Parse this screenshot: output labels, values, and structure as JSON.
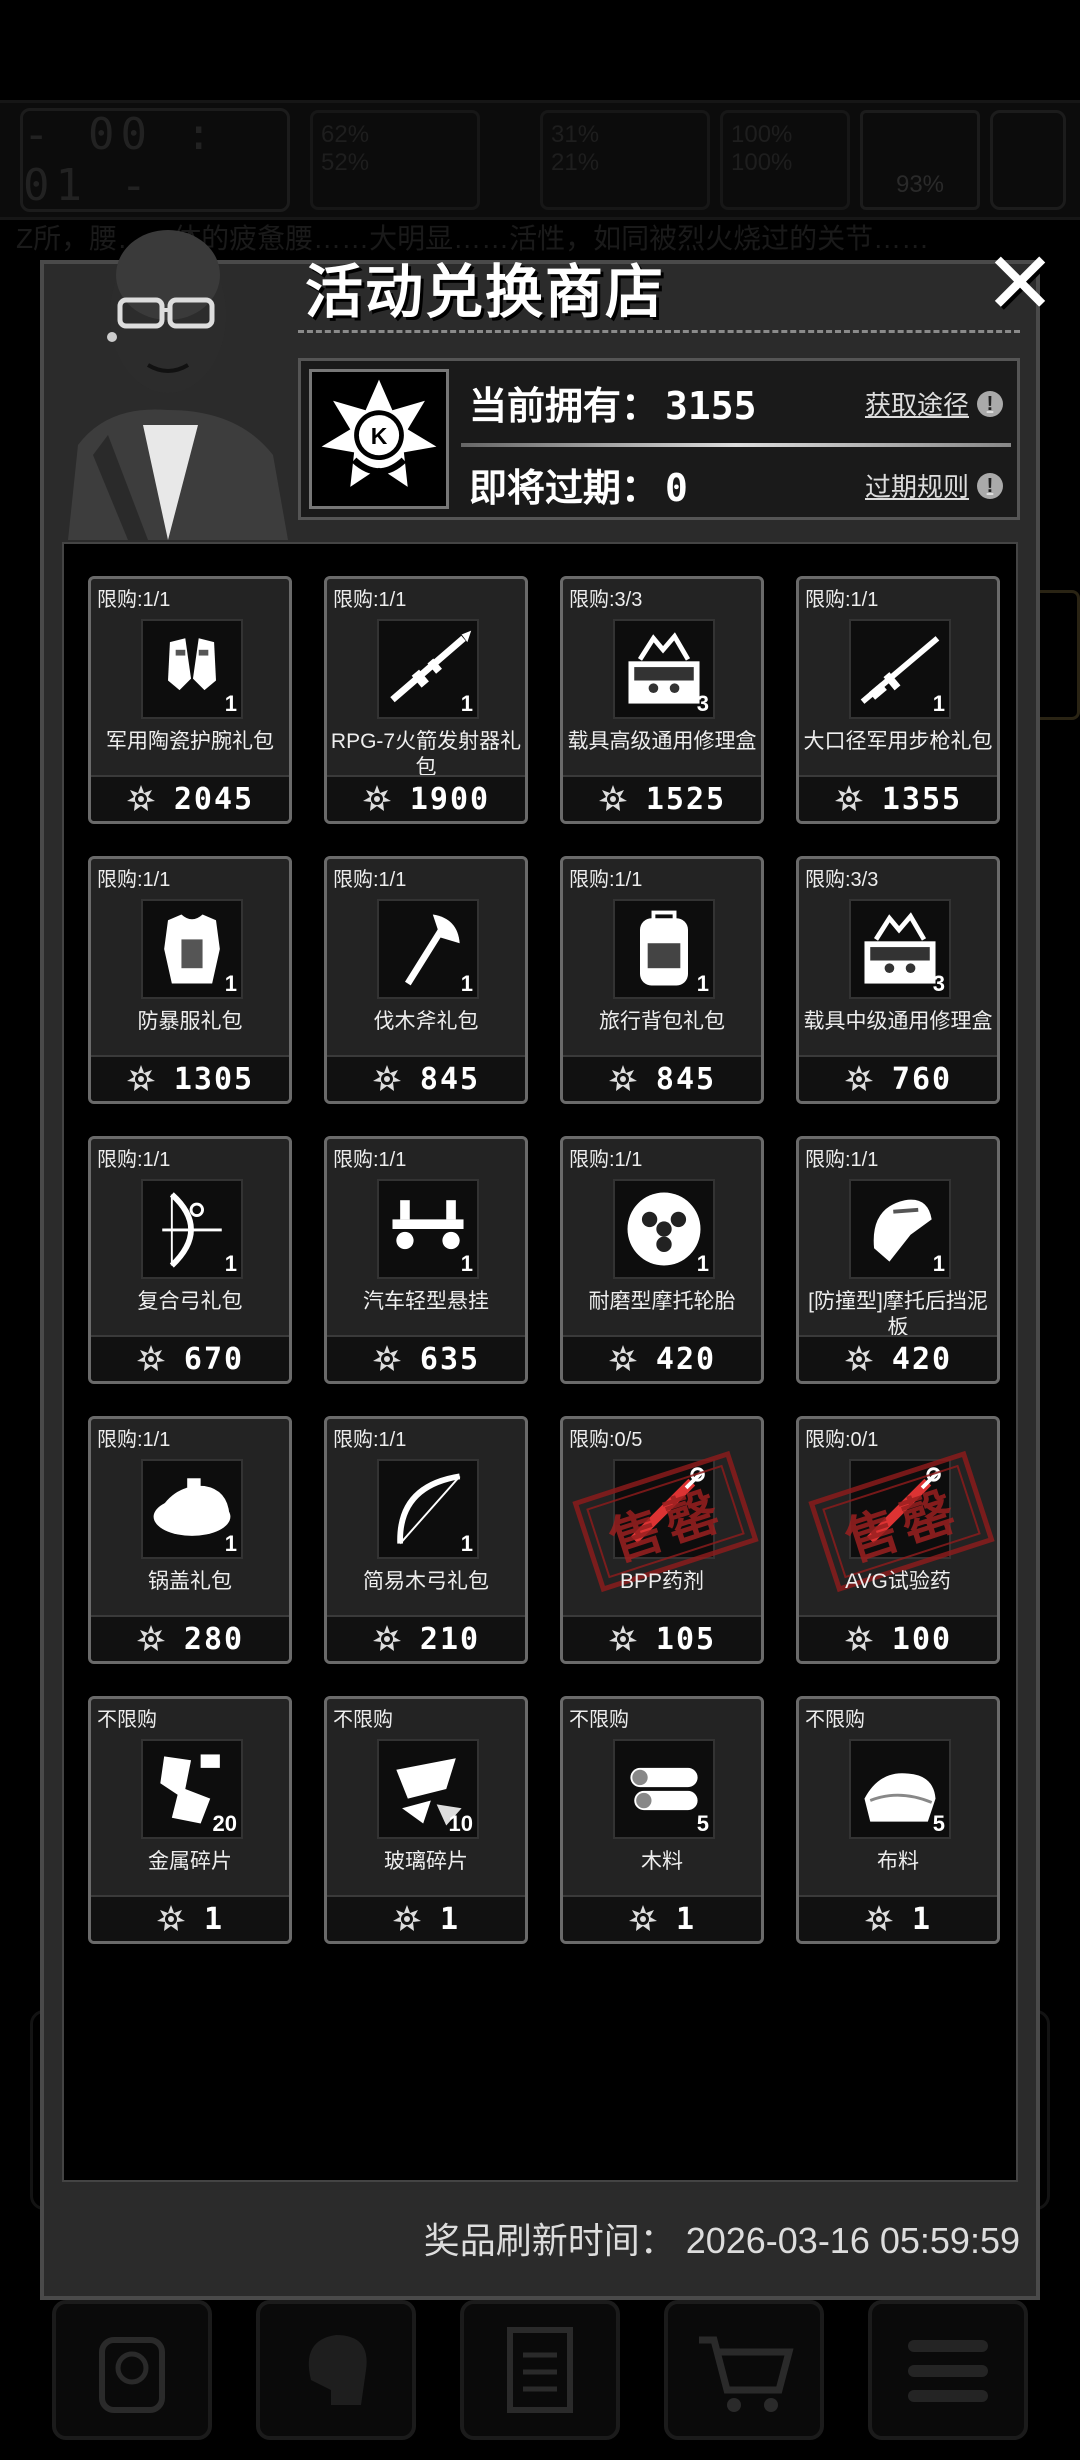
{
  "background": {
    "timer": "- 00 : 01 -",
    "stats": [
      "62%",
      "52%",
      "31%",
      "21%",
      "100%",
      "100%"
    ],
    "status_pct": "93%",
    "story_text": "Z所，腰……体的疲惫腰……大明显……活性，如同被烈火烧过的关节……"
  },
  "modal": {
    "title": "活动兑换商店",
    "close_symbol": "✕",
    "wallet": {
      "owned_label": "当前拥有：",
      "owned_value": "3155",
      "expiring_label": "即将过期：",
      "expiring_value": "0",
      "get_link": "获取途径",
      "expire_rule_link": "过期规则",
      "emblem_letter": "K"
    },
    "items": [
      {
        "limit": "限购:1/1",
        "qty": "1",
        "name": "军用陶瓷护腕礼包",
        "price": "2045",
        "icon": "bracer-icon",
        "sold_out": false
      },
      {
        "limit": "限购:1/1",
        "qty": "1",
        "name": "RPG-7火箭发射器礼包",
        "price": "1900",
        "icon": "rocket-launcher-icon",
        "sold_out": false
      },
      {
        "limit": "限购:3/3",
        "qty": "3",
        "name": "载具高级通用修理盒",
        "price": "1525",
        "icon": "toolbox-icon",
        "sold_out": false
      },
      {
        "limit": "限购:1/1",
        "qty": "1",
        "name": "大口径军用步枪礼包",
        "price": "1355",
        "icon": "rifle-icon",
        "sold_out": false
      },
      {
        "limit": "限购:1/1",
        "qty": "1",
        "name": "防暴服礼包",
        "price": "1305",
        "icon": "body-armor-icon",
        "sold_out": false
      },
      {
        "limit": "限购:1/1",
        "qty": "1",
        "name": "伐木斧礼包",
        "price": "845",
        "icon": "axe-icon",
        "sold_out": false
      },
      {
        "limit": "限购:1/1",
        "qty": "1",
        "name": "旅行背包礼包",
        "price": "845",
        "icon": "backpack-icon",
        "sold_out": false
      },
      {
        "limit": "限购:3/3",
        "qty": "3",
        "name": "载具中级通用修理盒",
        "price": "760",
        "icon": "toolbox-icon",
        "sold_out": false
      },
      {
        "limit": "限购:1/1",
        "qty": "1",
        "name": "复合弓礼包",
        "price": "670",
        "icon": "compound-bow-icon",
        "sold_out": false
      },
      {
        "limit": "限购:1/1",
        "qty": "1",
        "name": "汽车轻型悬挂",
        "price": "635",
        "icon": "suspension-icon",
        "sold_out": false
      },
      {
        "limit": "限购:1/1",
        "qty": "1",
        "name": "耐磨型摩托轮胎",
        "price": "420",
        "icon": "tire-icon",
        "sold_out": false
      },
      {
        "limit": "限购:1/1",
        "qty": "1",
        "name": "[防撞型]摩托后挡泥板",
        "price": "420",
        "icon": "fender-icon",
        "sold_out": false
      },
      {
        "limit": "限购:1/1",
        "qty": "1",
        "name": "锅盖礼包",
        "price": "280",
        "icon": "pot-lid-icon",
        "sold_out": false
      },
      {
        "limit": "限购:1/1",
        "qty": "1",
        "name": "简易木弓礼包",
        "price": "210",
        "icon": "wooden-bow-icon",
        "sold_out": false
      },
      {
        "limit": "限购:0/5",
        "qty": "",
        "name": "BPP药剂",
        "price": "105",
        "icon": "syringe-icon",
        "sold_out": true,
        "stamp": "售罄"
      },
      {
        "limit": "限购:0/1",
        "qty": "",
        "name": "AVG试验药",
        "price": "100",
        "icon": "syringe-icon",
        "sold_out": true,
        "stamp": "售罄"
      },
      {
        "limit": "不限购",
        "qty": "20",
        "name": "金属碎片",
        "price": "1",
        "icon": "metal-scrap-icon",
        "sold_out": false
      },
      {
        "limit": "不限购",
        "qty": "10",
        "name": "玻璃碎片",
        "price": "1",
        "icon": "glass-shard-icon",
        "sold_out": false
      },
      {
        "limit": "不限购",
        "qty": "5",
        "name": "木料",
        "price": "1",
        "icon": "wood-logs-icon",
        "sold_out": false
      },
      {
        "limit": "不限购",
        "qty": "5",
        "name": "布料",
        "price": "1",
        "icon": "cloth-icon",
        "sold_out": false
      }
    ],
    "refresh_text": "奖品刷新时间：  2026-03-16 05:59:59"
  },
  "bottom_nav": [
    {
      "name": "backpack-tab",
      "icon": "backpack-icon"
    },
    {
      "name": "brain-tab",
      "icon": "brain-icon"
    },
    {
      "name": "journal-tab",
      "icon": "journal-icon"
    },
    {
      "name": "shop-tab",
      "icon": "cart-icon"
    },
    {
      "name": "menu-tab",
      "icon": "menu-icon"
    }
  ],
  "colors": {
    "modal_bg": "#2b2b2b",
    "stamp_red": "#8a1c1c",
    "card_border": "#6a6a6a"
  }
}
